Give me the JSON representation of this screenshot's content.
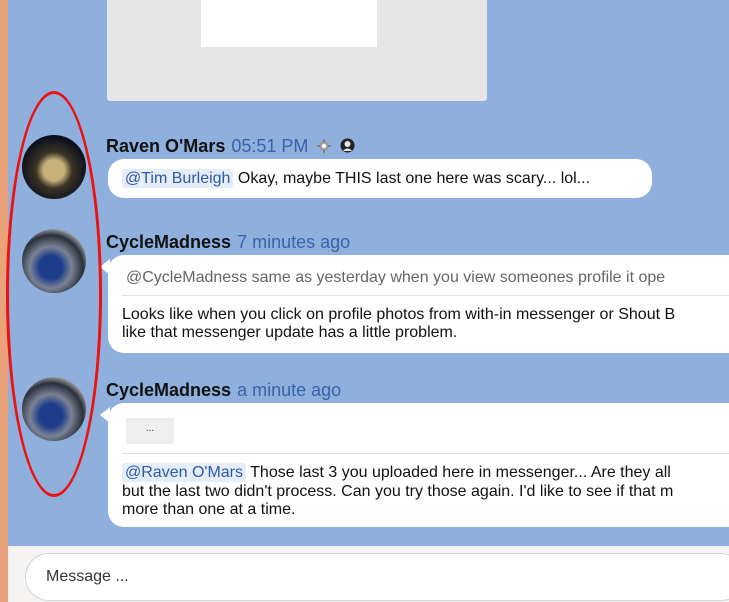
{
  "messages": [
    {
      "author": "Raven O'Mars",
      "time": "05:51 PM",
      "icons": [
        "gear-badge-icon",
        "user-badge-icon"
      ],
      "mention": "@Tim Burleigh",
      "text": "Okay, maybe THIS last one here was scary... lol..."
    },
    {
      "author": "CycleMadness",
      "time": "7 minutes ago",
      "quote": "@CycleMadness same as yesterday when you view someones profile it ope",
      "lines": [
        "Looks like when you click on profile photos from with-in messenger or Shout B",
        "like that messenger update has a little problem."
      ]
    },
    {
      "author": "CycleMadness",
      "time": "a minute ago",
      "more_label": "...",
      "mention": "@Raven O'Mars",
      "lines": [
        "Those last 3 you uploaded here in messenger... Are they all",
        "but the last two didn't process. Can you try those again. I'd like to see if that m",
        "more than one at a time."
      ]
    }
  ],
  "input": {
    "placeholder": "Message ..."
  },
  "colors": {
    "chat_bg": "#8fb0dd",
    "annotation": "#ee1111",
    "mention_text": "#2f5aa8"
  }
}
